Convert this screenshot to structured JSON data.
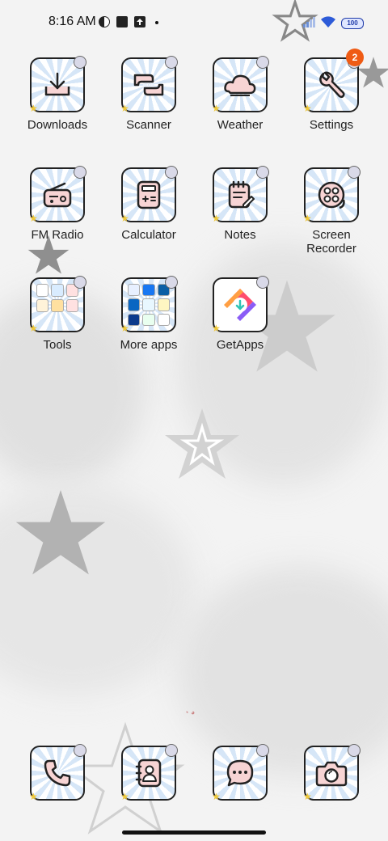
{
  "status_bar": {
    "time": "8:16 AM",
    "battery": "100"
  },
  "apps": [
    {
      "label": "Downloads",
      "icon": "download-icon"
    },
    {
      "label": "Scanner",
      "icon": "scanner-icon"
    },
    {
      "label": "Weather",
      "icon": "cloud-icon"
    },
    {
      "label": "Settings",
      "icon": "wrench-icon",
      "badge": "2"
    },
    {
      "label": "FM Radio",
      "icon": "radio-icon"
    },
    {
      "label": "Calculator",
      "icon": "calculator-icon"
    },
    {
      "label": "Notes",
      "icon": "notes-icon"
    },
    {
      "label": "Screen Recorder",
      "icon": "record-icon"
    },
    {
      "label": "Tools",
      "icon": "folder-icon"
    },
    {
      "label": "More apps",
      "icon": "folder-icon"
    },
    {
      "label": "GetApps",
      "icon": "getapps-icon"
    }
  ],
  "dock": [
    {
      "icon": "phone-icon"
    },
    {
      "icon": "contacts-icon"
    },
    {
      "icon": "messages-icon"
    },
    {
      "icon": "camera-icon"
    }
  ],
  "colors": {
    "accent_pink": "#f7d4d4",
    "tile_stripe": "#d6e6f7",
    "badge": "#ef5b14"
  }
}
